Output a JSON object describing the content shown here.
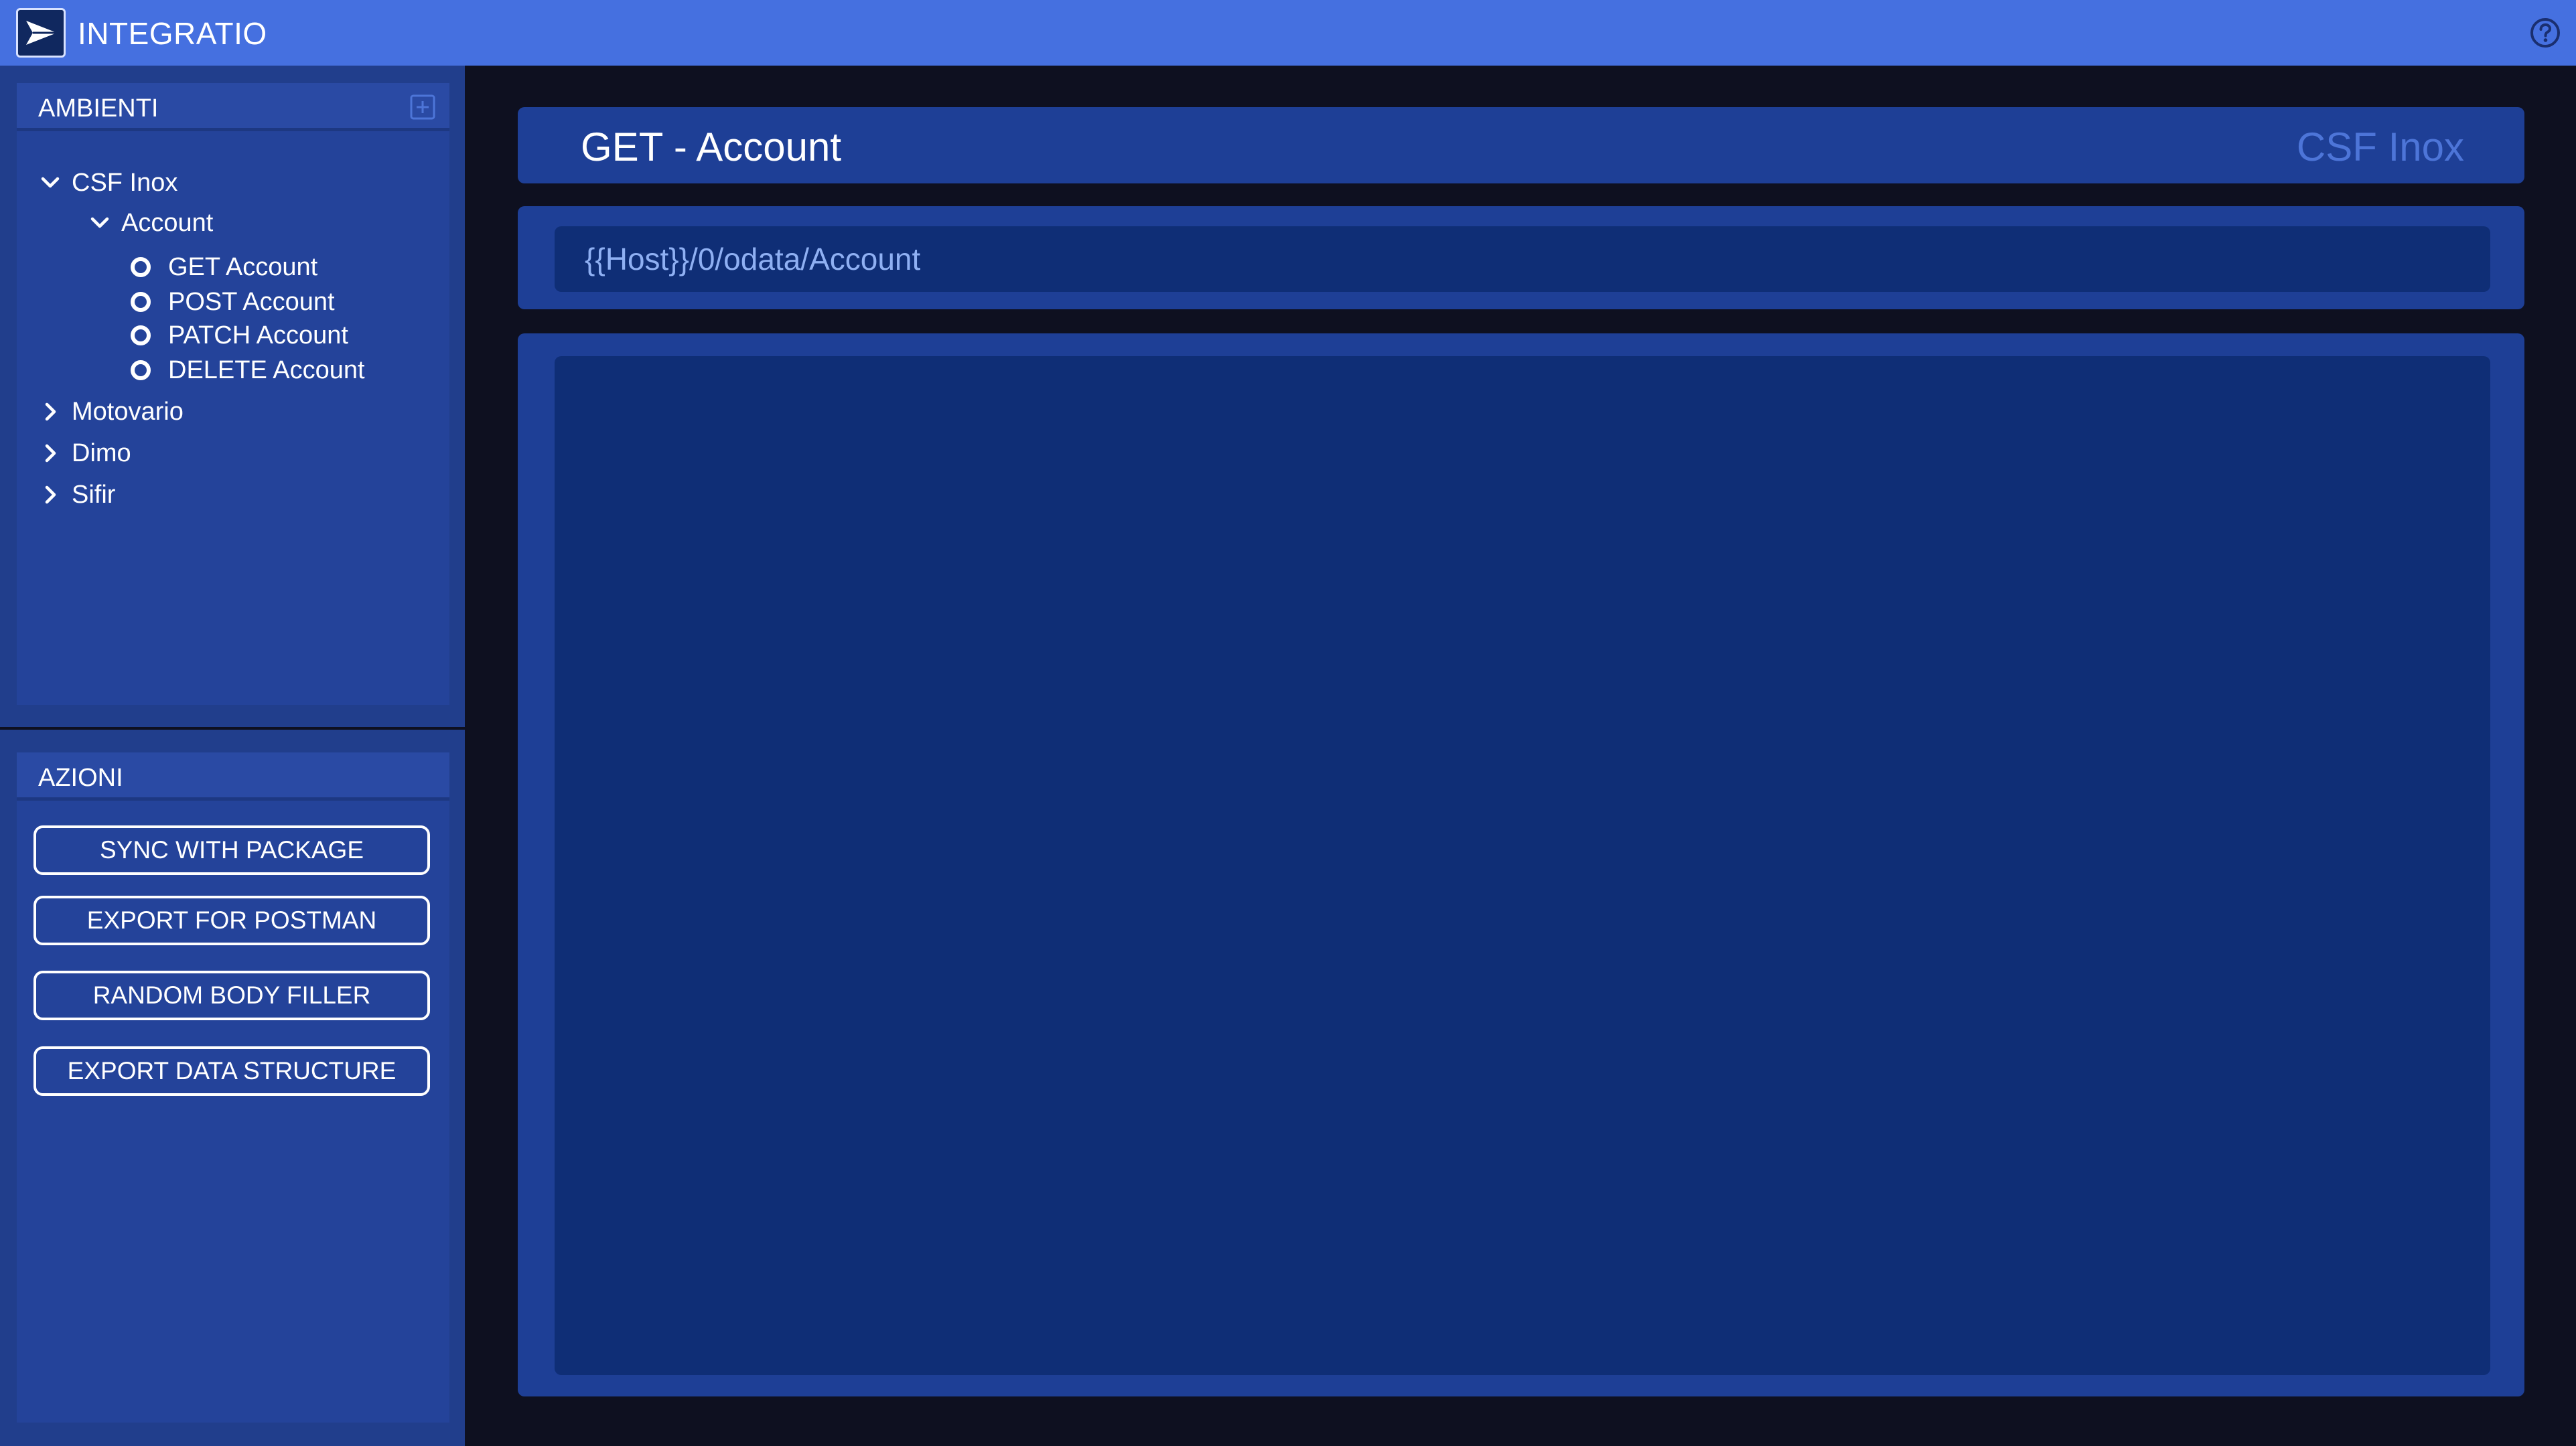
{
  "app": {
    "title": "INTEGRATIO",
    "logo_icon": "paper-plane-logo-icon",
    "help_icon": "help-circle-icon"
  },
  "colors": {
    "topbar": "#4570e0",
    "sidebar": "#213e8c",
    "panel": "#24439a",
    "card": "#1e3f96",
    "field": "#0f2e76",
    "background": "#0e1020",
    "accent_text": "#4d75d8",
    "url_text": "#8fb0f3"
  },
  "environments_panel": {
    "title": "AMBIENTI",
    "add_icon": "plus-square-icon",
    "tree": [
      {
        "label": "CSF Inox",
        "expanded": true,
        "children": [
          {
            "label": "Account",
            "expanded": true,
            "requests": [
              "GET Account",
              "POST Account",
              "PATCH Account",
              "DELETE Account"
            ]
          }
        ]
      },
      {
        "label": "Motovario",
        "expanded": false
      },
      {
        "label": "Dimo",
        "expanded": false
      },
      {
        "label": "Sifir",
        "expanded": false
      }
    ]
  },
  "actions_panel": {
    "title": "AZIONI",
    "buttons": [
      "SYNC WITH PACKAGE",
      "EXPORT FOR POSTMAN",
      "RANDOM BODY FILLER",
      "EXPORT DATA STRUCTURE"
    ]
  },
  "request": {
    "title": "GET - Account",
    "environment": "CSF Inox",
    "url": "{{Host}}/0/odata/Account",
    "body": ""
  }
}
